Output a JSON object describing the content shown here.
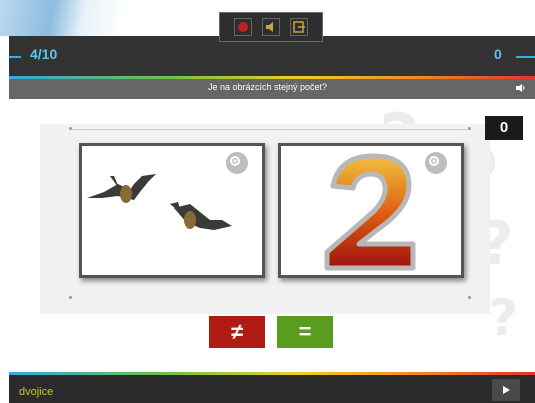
{
  "header": {
    "counter": "4/10",
    "score": "0"
  },
  "toolbar": {
    "icons": [
      "record-icon",
      "sound-icon",
      "exit-icon"
    ]
  },
  "question": {
    "text": "Je na obrázcích stejný počet?"
  },
  "answer_display": "0",
  "cards": [
    {
      "content": "two-bats-image",
      "count": 2
    },
    {
      "content": "number-2-image",
      "count": 2
    }
  ],
  "buttons": {
    "not_equal_label": "≠",
    "equal_label": "="
  },
  "footer": {
    "game_name": "dvojice"
  },
  "colors": {
    "accent_blue": "#5fc4f0",
    "not_equal_red": "#b01c14",
    "equal_green": "#5a9c1e",
    "footer_text": "#c7c92a"
  }
}
